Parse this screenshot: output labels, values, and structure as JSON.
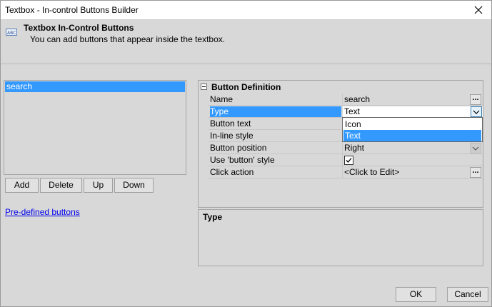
{
  "window": {
    "title": "Textbox - In-control Buttons Builder",
    "close_icon": "close-icon"
  },
  "header": {
    "title": "Textbox In-Control Buttons",
    "subtitle": "You can add buttons that appear inside the textbox.",
    "icon": "textbox-icon"
  },
  "buttons_list": {
    "items": [
      "search"
    ],
    "selected": "search"
  },
  "list_actions": {
    "add": "Add",
    "delete": "Delete",
    "up": "Up",
    "down": "Down"
  },
  "predefined_link": "Pre-defined buttons",
  "property_grid": {
    "category": "Button Definition",
    "rows": [
      {
        "name": "Name",
        "value": "search"
      },
      {
        "name": "Type",
        "value": "Text"
      },
      {
        "name": "Button text",
        "value": ""
      },
      {
        "name": "In-line style",
        "value": ""
      },
      {
        "name": "Button position",
        "value": "Right"
      },
      {
        "name": "Use 'button' style",
        "value": "checked"
      },
      {
        "name": "Click action",
        "value": "<Click to Edit>"
      }
    ],
    "dropdown_options": [
      "Icon",
      "Text"
    ],
    "dropdown_selected": "Text",
    "ellipsis": "..."
  },
  "description": {
    "title": "Type"
  },
  "footer": {
    "ok": "OK",
    "cancel": "Cancel"
  },
  "colors": {
    "selection": "#3399ff",
    "background": "#d8d8d8",
    "link": "#0000ee"
  }
}
